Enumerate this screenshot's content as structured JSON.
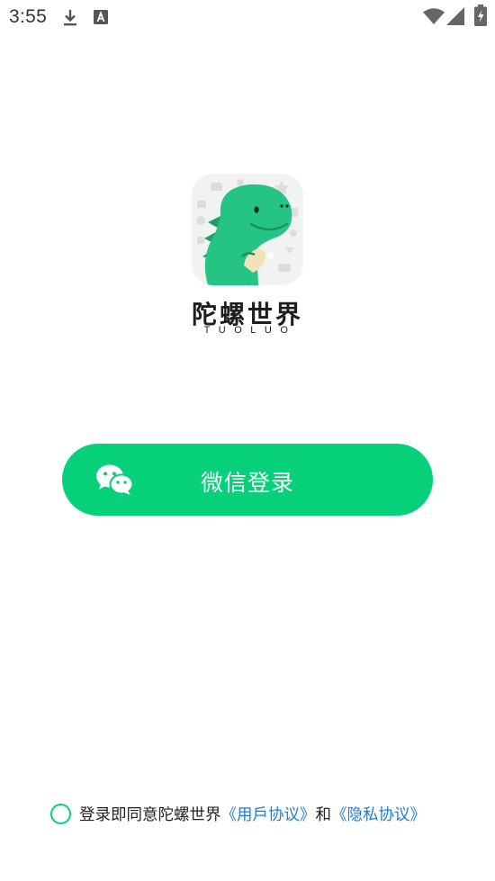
{
  "status_bar": {
    "time": "3:55",
    "icons": [
      "download-icon",
      "keyboard-a-icon",
      "wifi-icon",
      "signal-icon",
      "battery-charging-icon"
    ]
  },
  "brand": {
    "name": "陀螺世界",
    "subtitle": "TUOLUO",
    "logo_icon": "dinosaur-logo-icon"
  },
  "login": {
    "wechat_button_label": "微信登录",
    "wechat_icon": "wechat-icon"
  },
  "agreement": {
    "prefix": "登录即同意陀螺世界",
    "user_agreement": "《用戶协议》",
    "conjunction": "和",
    "privacy_policy": "《隐私协议》"
  },
  "colors": {
    "primary_green": "#07d07a",
    "link_blue": "#1c7dd8",
    "text_dark": "#222222",
    "background": "#ffffff"
  }
}
